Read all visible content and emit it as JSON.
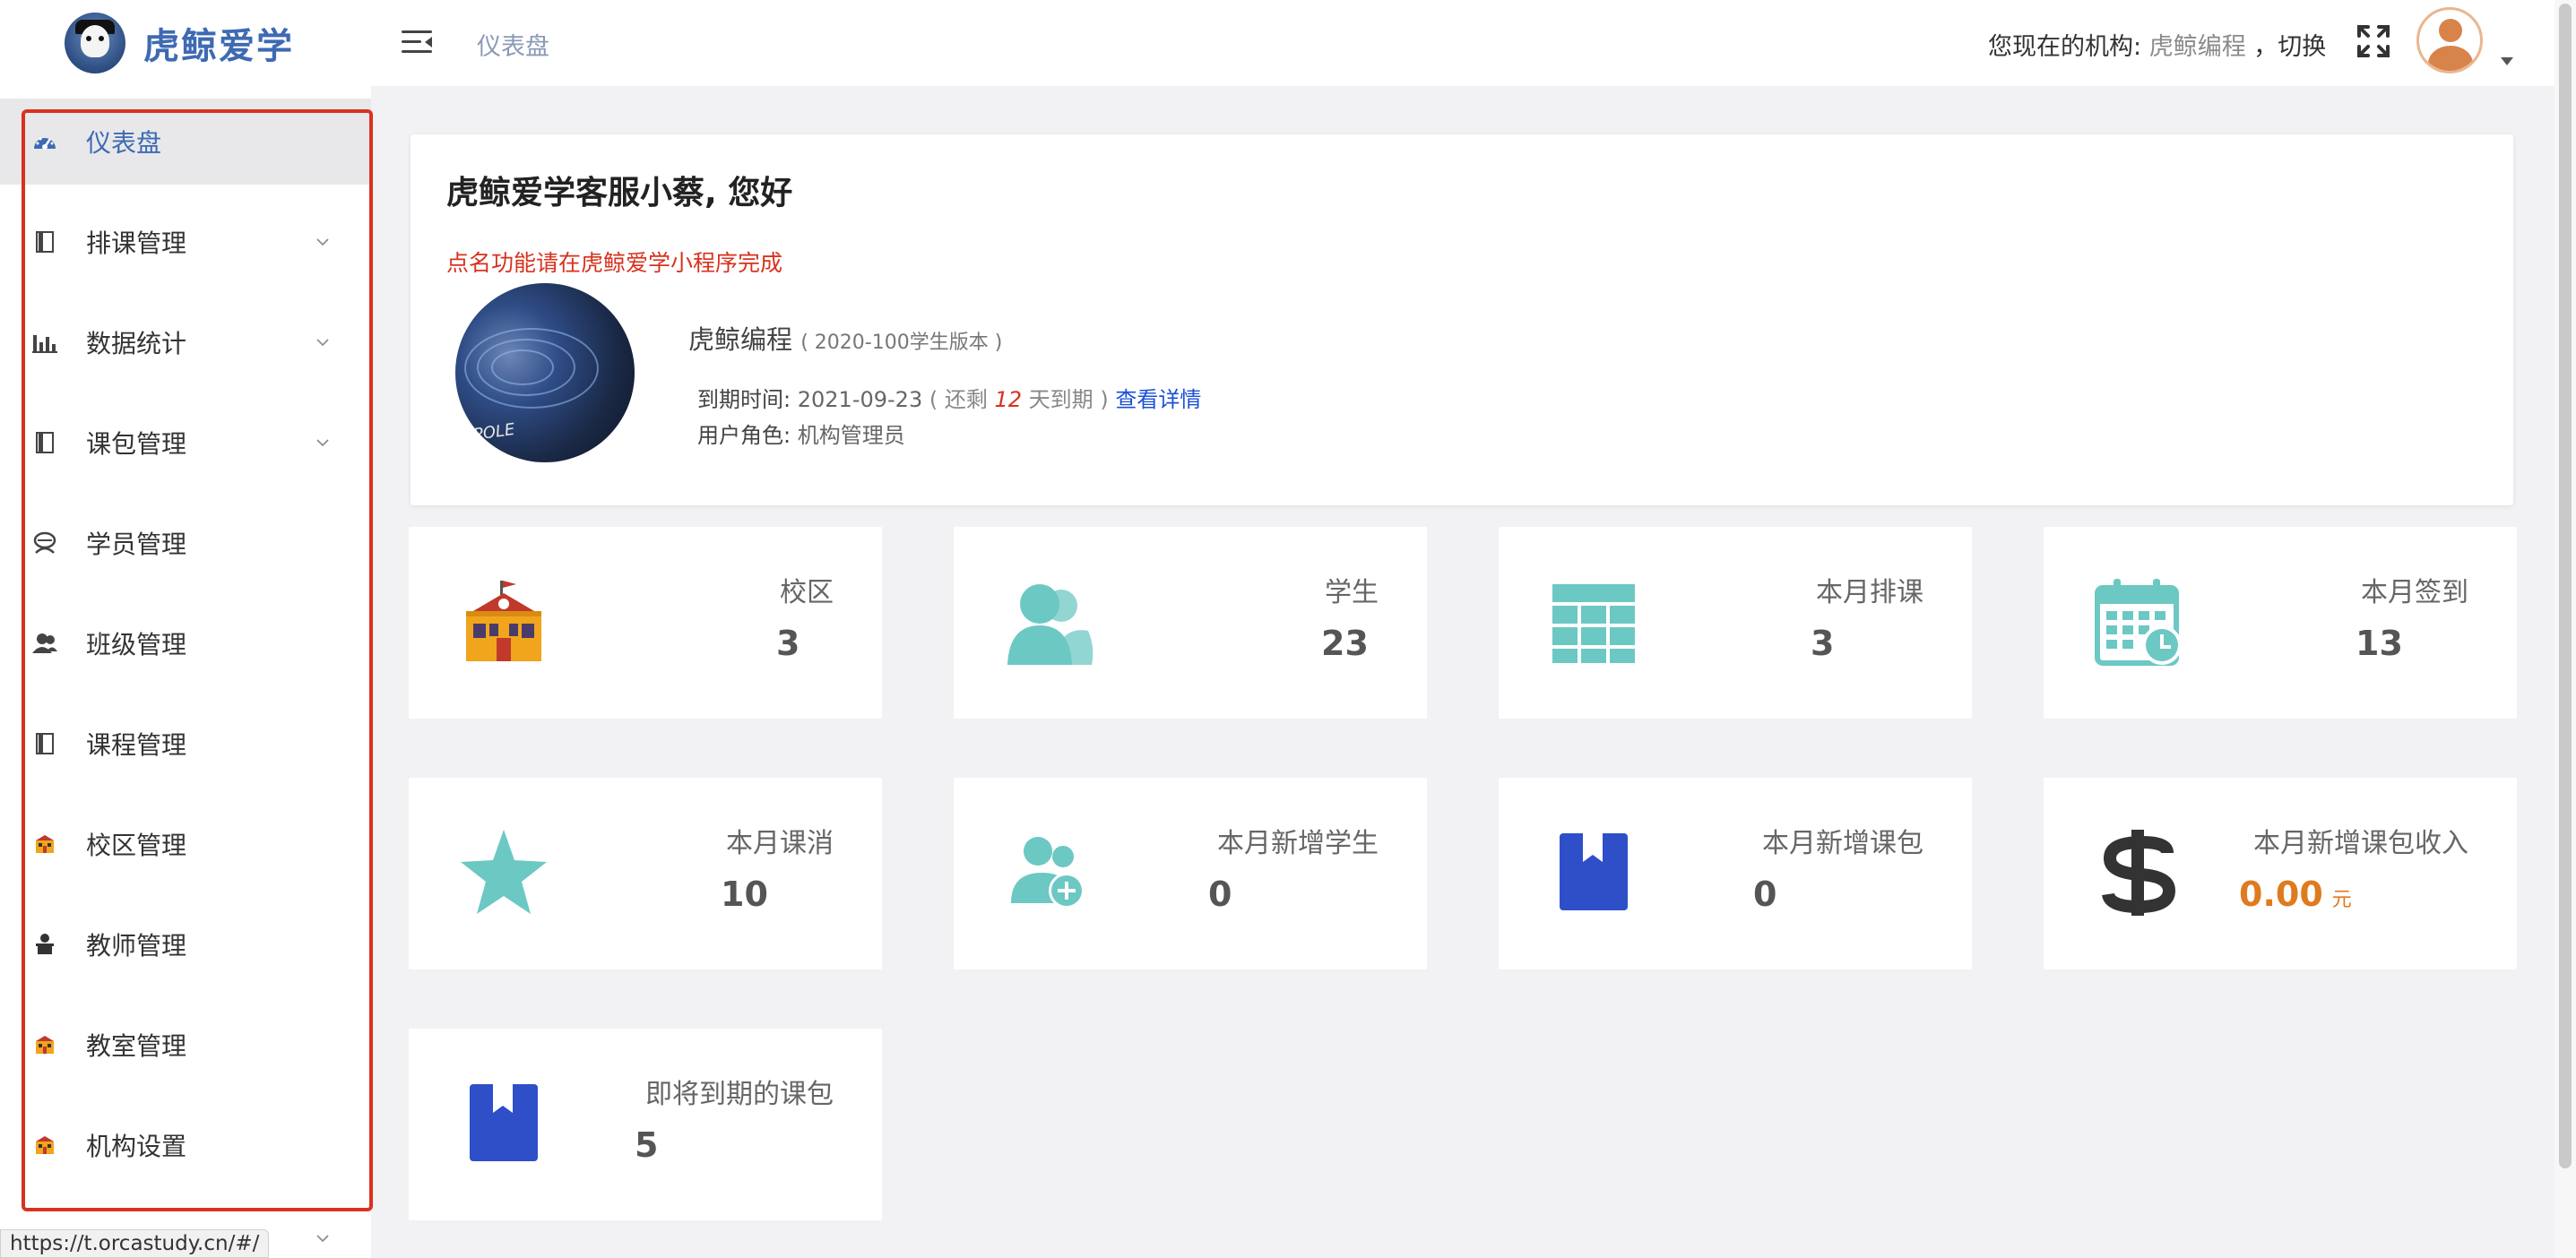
{
  "app": {
    "name": "虎鲸爱学"
  },
  "header": {
    "breadcrumb": "仪表盘",
    "org_prefix": "您现在的机构:",
    "org_name": "虎鲸编程",
    "org_switch": "，切换"
  },
  "sidebar": {
    "items": [
      {
        "label": "仪表盘",
        "icon": "dashboard-icon",
        "active": true
      },
      {
        "label": "排课管理",
        "icon": "book-icon",
        "expandable": true
      },
      {
        "label": "数据统计",
        "icon": "bar-chart-icon",
        "expandable": true
      },
      {
        "label": "课包管理",
        "icon": "book-icon",
        "expandable": true
      },
      {
        "label": "学员管理",
        "icon": "student-icon"
      },
      {
        "label": "班级管理",
        "icon": "users-icon"
      },
      {
        "label": "课程管理",
        "icon": "book-icon"
      },
      {
        "label": "校区管理",
        "icon": "school-icon"
      },
      {
        "label": "教师管理",
        "icon": "teacher-icon"
      },
      {
        "label": "教室管理",
        "icon": "school-icon"
      },
      {
        "label": "机构设置",
        "icon": "school-icon"
      }
    ],
    "status_url": "https://t.orcastudy.cn/#/"
  },
  "welcome": {
    "title": "虎鲸爱学客服小蔡, 您好",
    "notice": "点名功能请在虎鲸爱学小程序完成",
    "org_name": "虎鲸编程",
    "version": "( 2020-100学生版本 )",
    "expire_label": "到期时间:",
    "expire_date": "2021-09-23",
    "remain_prefix": "( 还剩",
    "remain_days": "12",
    "remain_suffix": "天到期 )",
    "detail_link": "查看详情",
    "role_label": "用户角色:",
    "role_value": "机构管理员",
    "photo_caption": "POLE"
  },
  "stats": [
    {
      "label": "校区",
      "value": "3",
      "icon": "school-building-icon"
    },
    {
      "label": "学生",
      "value": "23",
      "icon": "students-icon"
    },
    {
      "label": "本月排课",
      "value": "3",
      "icon": "table-grid-icon"
    },
    {
      "label": "本月签到",
      "value": "13",
      "icon": "calendar-clock-icon"
    },
    {
      "label": "本月课消",
      "value": "10",
      "icon": "star-icon"
    },
    {
      "label": "本月新增学生",
      "value": "0",
      "icon": "add-user-icon"
    },
    {
      "label": "本月新增课包",
      "value": "0",
      "icon": "bookmark-icon"
    },
    {
      "label": "本月新增课包收入",
      "value": "0.00",
      "unit": "元",
      "icon": "dollar-icon"
    },
    {
      "label": "即将到期的课包",
      "value": "5",
      "icon": "bookmark-icon"
    }
  ],
  "colors": {
    "brand": "#3e6ab3",
    "teal": "#6cc8c3",
    "blue": "#2f4fc9",
    "highlight": "#d8321e",
    "money": "#e07a1f"
  }
}
